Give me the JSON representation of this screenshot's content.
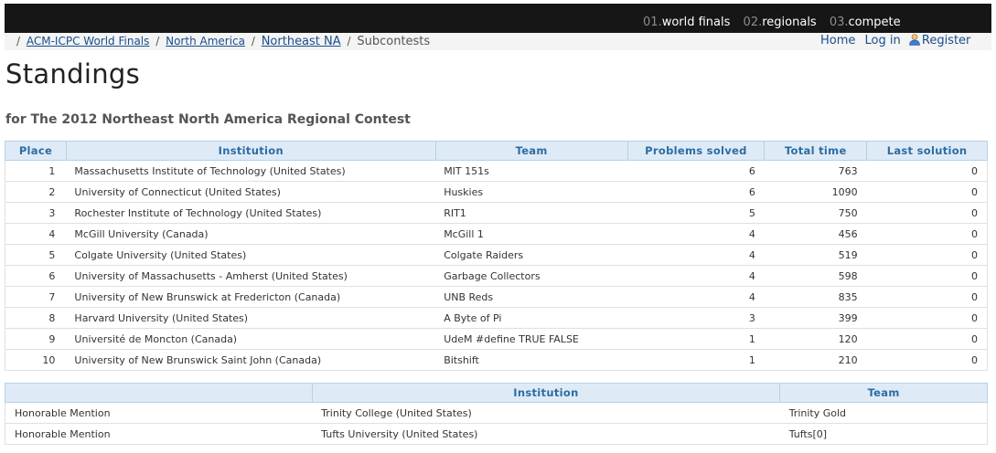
{
  "topnav": [
    {
      "num": "01.",
      "label": "world finals"
    },
    {
      "num": "02.",
      "label": "regionals"
    },
    {
      "num": "03.",
      "label": "compete"
    }
  ],
  "breadcrumb": {
    "sep": "/",
    "items": [
      "ACM-ICPC World Finals",
      "North America",
      "Northeast NA"
    ],
    "current": "Subcontests"
  },
  "usernav": {
    "home": "Home",
    "login": "Log in",
    "register": "Register"
  },
  "page": {
    "title": "Standings",
    "subtitle": "for The 2012 Northeast North America Regional Contest"
  },
  "standings": {
    "headers": [
      "Place",
      "Institution",
      "Team",
      "Problems solved",
      "Total time",
      "Last solution"
    ],
    "rows": [
      {
        "place": "1",
        "institution": "Massachusetts Institute of Technology (United States)",
        "team": "MIT 151s",
        "solved": "6",
        "time": "763",
        "last": "0"
      },
      {
        "place": "2",
        "institution": "University of Connecticut (United States)",
        "team": "Huskies",
        "solved": "6",
        "time": "1090",
        "last": "0"
      },
      {
        "place": "3",
        "institution": "Rochester Institute of Technology (United States)",
        "team": "RIT1",
        "solved": "5",
        "time": "750",
        "last": "0"
      },
      {
        "place": "4",
        "institution": "McGill University (Canada)",
        "team": "McGill 1",
        "solved": "4",
        "time": "456",
        "last": "0"
      },
      {
        "place": "5",
        "institution": "Colgate University (United States)",
        "team": "Colgate Raiders",
        "solved": "4",
        "time": "519",
        "last": "0"
      },
      {
        "place": "6",
        "institution": "University of Massachusetts - Amherst (United States)",
        "team": "Garbage Collectors",
        "solved": "4",
        "time": "598",
        "last": "0"
      },
      {
        "place": "7",
        "institution": "University of New Brunswick at Fredericton (Canada)",
        "team": "UNB Reds",
        "solved": "4",
        "time": "835",
        "last": "0"
      },
      {
        "place": "8",
        "institution": "Harvard University (United States)",
        "team": "A Byte of Pi",
        "solved": "3",
        "time": "399",
        "last": "0"
      },
      {
        "place": "9",
        "institution": "Université de Moncton (Canada)",
        "team": "UdeM #define TRUE FALSE",
        "solved": "1",
        "time": "120",
        "last": "0"
      },
      {
        "place": "10",
        "institution": "University of New Brunswick Saint John (Canada)",
        "team": "Bitshift",
        "solved": "1",
        "time": "210",
        "last": "0"
      }
    ]
  },
  "honorable": {
    "headers": [
      "",
      "Institution",
      "Team"
    ],
    "rows": [
      {
        "label": "Honorable Mention",
        "institution": "Trinity College (United States)",
        "team": "Trinity Gold"
      },
      {
        "label": "Honorable Mention",
        "institution": "Tufts University (United States)",
        "team": "Tufts[0]"
      }
    ]
  },
  "icons": {
    "register": "user-icon"
  },
  "colors": {
    "topbar": "#161616",
    "header_bg": "#deebf7",
    "header_text": "#2d6ca2",
    "link": "#1a4d8e"
  }
}
